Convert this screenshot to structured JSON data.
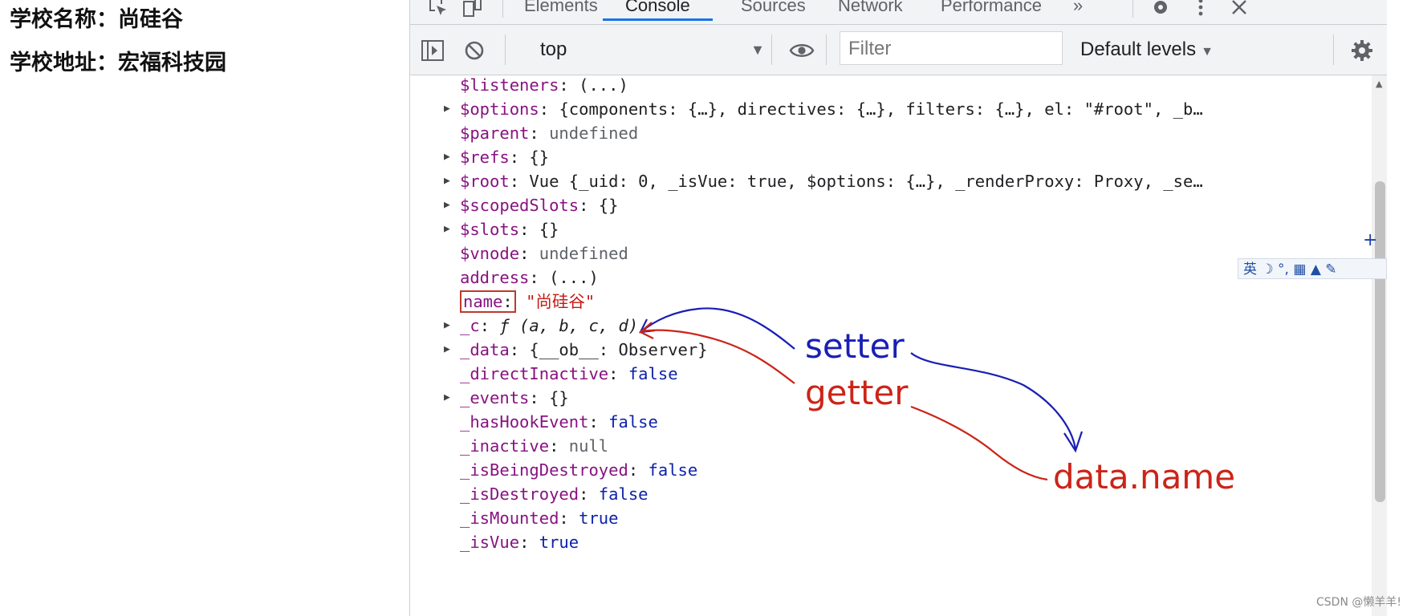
{
  "page": {
    "lines": [
      "学校名称：尚硅谷",
      "学校地址：宏福科技园"
    ]
  },
  "devtools": {
    "tabs": [
      "Elements",
      "Console",
      "Sources",
      "Network",
      "Performance"
    ],
    "more_tabs": "»",
    "active_tab": "Console",
    "toolbar": {
      "context": "top",
      "filter_placeholder": "Filter",
      "levels": "Default levels"
    }
  },
  "console": {
    "rows": [
      {
        "key": "$listeners",
        "value": "(...)"
      },
      {
        "key": "$options",
        "value": "{components: {…}, directives: {…}, filters: {…}, el: \"#root\", _b…"
      },
      {
        "key": "$parent",
        "value": "undefined"
      },
      {
        "key": "$refs",
        "value": "{}"
      },
      {
        "key": "$root",
        "value": "Vue {_uid: 0, _isVue: true, $options: {…}, _renderProxy: Proxy, _se…"
      },
      {
        "key": "$scopedSlots",
        "value": "{}"
      },
      {
        "key": "$slots",
        "value": "{}"
      },
      {
        "key": "$vnode",
        "value": "undefined"
      },
      {
        "key": "address",
        "value": "(...)"
      },
      {
        "key": "name",
        "value": "\"尚硅谷\""
      },
      {
        "key": "_c",
        "value": "ƒ (a, b, c, d)"
      },
      {
        "key": "_data",
        "value": "{__ob__: Observer}"
      },
      {
        "key": "_directInactive",
        "value": "false"
      },
      {
        "key": "_events",
        "value": "{}"
      },
      {
        "key": "_hasHookEvent",
        "value": "false"
      },
      {
        "key": "_inactive",
        "value": "null"
      },
      {
        "key": "_isBeingDestroyed",
        "value": "false"
      },
      {
        "key": "_isDestroyed",
        "value": "false"
      },
      {
        "key": "_isMounted",
        "value": "true"
      },
      {
        "key": "_isVue",
        "value": "true"
      }
    ]
  },
  "annotations": {
    "setter": "setter",
    "getter": "getter",
    "target": "data.name",
    "colors": {
      "blue": "#1a1fb5",
      "red": "#cc2418"
    }
  },
  "ime_bar": "英 ☽ °, ▦ ▲ ✎",
  "watermark": "CSDN @懒羊羊!"
}
